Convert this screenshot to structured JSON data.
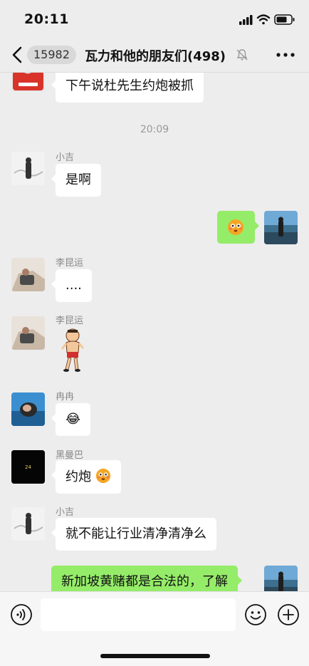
{
  "status_bar": {
    "time": "20:11"
  },
  "header": {
    "unread_count": "15982",
    "title": "瓦力和他的朋友们(498)"
  },
  "chat": {
    "timestamp": "20:09",
    "messages": [
      {
        "text": "下午说杜先生约炮被抓"
      },
      {
        "sender": "小吉",
        "text": "是啊"
      },
      {
        "sender": "李昆运",
        "text": "...."
      },
      {
        "sender": "李昆运",
        "sticker": "dancing-man-sticker"
      },
      {
        "sender": "冉冉",
        "text": "😂"
      },
      {
        "sender": "黑曼巴",
        "text": "约炮"
      },
      {
        "sender": "小吉",
        "text": "就不能让行业清净清净么"
      },
      {
        "text": "新加坡黄赌都是合法的，了解"
      }
    ]
  },
  "input": {
    "placeholder": ""
  },
  "colors": {
    "outgoing_bubble": "#95ec69",
    "incoming_bubble": "#ffffff",
    "background": "#ededed"
  }
}
